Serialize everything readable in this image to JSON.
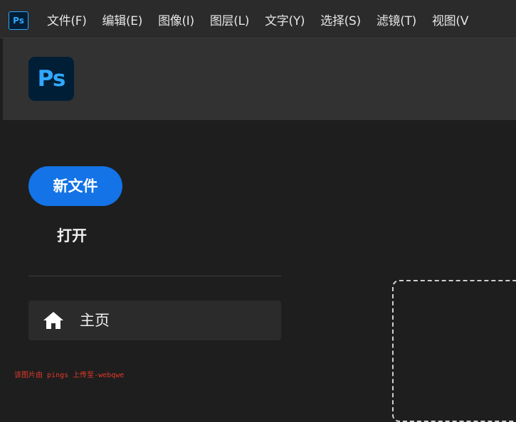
{
  "app": {
    "icon_text": "Ps",
    "logo_text": "Ps",
    "brand_color": "#31a8ff",
    "brand_bg": "#001e36"
  },
  "menu": {
    "items": [
      "文件(F)",
      "编辑(E)",
      "图像(I)",
      "图层(L)",
      "文字(Y)",
      "选择(S)",
      "滤镜(T)",
      "视图(V"
    ]
  },
  "home": {
    "new_file_label": "新文件",
    "open_label": "打开",
    "nav_home_label": "主页",
    "accent_color": "#1473e6"
  },
  "icons": {
    "home": "home-icon"
  },
  "watermark": {
    "text": "该图片由 pings 上传至-webqwe"
  }
}
